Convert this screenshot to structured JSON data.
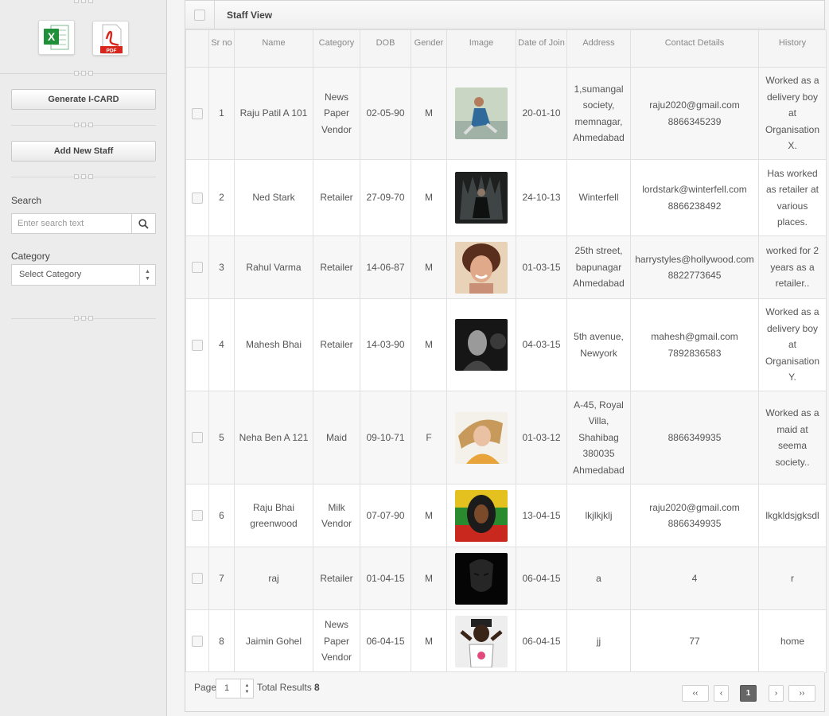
{
  "sidebar": {
    "generate_icard_label": "Generate I-CARD",
    "add_new_staff_label": "Add New Staff",
    "search_label": "Search",
    "search_placeholder": "Enter search text",
    "category_label": "Category",
    "category_selected": "Select Category"
  },
  "panel": {
    "title": "Staff View",
    "columns": [
      "Sr no",
      "Name",
      "Category",
      "DOB",
      "Gender",
      "Image",
      "Date of Join",
      "Address",
      "Contact Details",
      "History"
    ],
    "rows": [
      {
        "sr": "1",
        "name": "Raju Patil A 101",
        "category": "News Paper Vendor",
        "dob": "02-05-90",
        "gender": "M",
        "image": "photo-1",
        "doj": "20-01-10",
        "address": "1,sumangal society, memnagar, Ahmedabad",
        "contact": "raju2020@gmail.com 8866345239",
        "history": "Worked as a delivery boy at Organisation X."
      },
      {
        "sr": "2",
        "name": "Ned Stark",
        "category": "Retailer",
        "dob": "27-09-70",
        "gender": "M",
        "image": "photo-2",
        "doj": "24-10-13",
        "address": "Winterfell",
        "contact": "lordstark@winterfell.com 8866238492",
        "history": "Has worked as retailer at various places."
      },
      {
        "sr": "3",
        "name": "Rahul Varma",
        "category": "Retailer",
        "dob": "14-06-87",
        "gender": "M",
        "image": "photo-3",
        "doj": "01-03-15",
        "address": "25th street, bapunagar Ahmedabad",
        "contact": "harrystyles@hollywood.com 8822773645",
        "history": "worked for 2 years as a retailer.."
      },
      {
        "sr": "4",
        "name": "Mahesh Bhai",
        "category": "Retailer",
        "dob": "14-03-90",
        "gender": "M",
        "image": "photo-4",
        "doj": "04-03-15",
        "address": "5th avenue, Newyork",
        "contact": "mahesh@gmail.com 7892836583",
        "history": "Worked as a delivery boy at Organisation Y."
      },
      {
        "sr": "5",
        "name": "Neha Ben A 121",
        "category": "Maid",
        "dob": "09-10-71",
        "gender": "F",
        "image": "photo-5",
        "doj": "01-03-12",
        "address": "A-45, Royal Villa, Shahibag 380035 Ahmedabad",
        "contact": "8866349935",
        "history": "Worked as a maid at seema society.."
      },
      {
        "sr": "6",
        "name": "Raju Bhai greenwood",
        "category": "Milk Vendor",
        "dob": "07-07-90",
        "gender": "M",
        "image": "photo-6",
        "doj": "13-04-15",
        "address": "lkjlkjklj",
        "contact": "raju2020@gmail.com 8866349935",
        "history": "lkgkldsjgksdl"
      },
      {
        "sr": "7",
        "name": "raj",
        "category": "Retailer",
        "dob": "01-04-15",
        "gender": "M",
        "image": "photo-7",
        "doj": "06-04-15",
        "address": "a",
        "contact": "4",
        "history": "r"
      },
      {
        "sr": "8",
        "name": "Jaimin Gohel",
        "category": "News Paper Vendor",
        "dob": "06-04-15",
        "gender": "M",
        "image": "photo-8",
        "doj": "06-04-15",
        "address": "jj",
        "contact": "77",
        "history": "home"
      }
    ]
  },
  "footer": {
    "page_label": "Page",
    "page_value": "1",
    "total_label": "Total Results",
    "total_value": "8",
    "first_label": "‹‹",
    "prev_label": "‹",
    "current_page": "1",
    "next_label": "›",
    "last_label": "››"
  },
  "icons": {
    "excel": "excel-export-icon",
    "pdf": "pdf-export-icon",
    "search": "search-icon"
  },
  "colors": {
    "excel_green": "#1f8f3a",
    "pdf_red": "#d9261c"
  }
}
